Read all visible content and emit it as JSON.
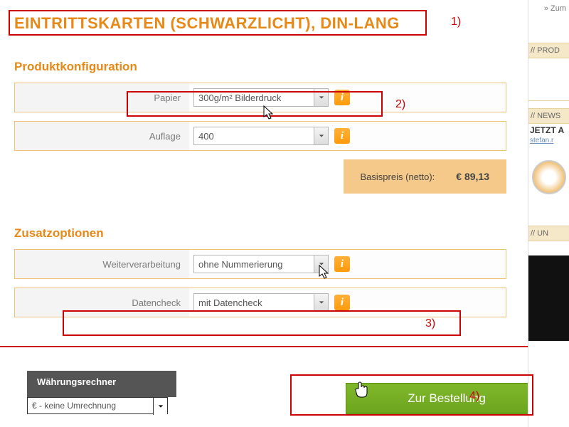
{
  "title": "EINTRITTSKARTEN (SCHWARZLICHT), DIN-LANG",
  "sections": {
    "config": {
      "title": "Produktkonfiguration",
      "paper": {
        "label": "Papier",
        "value": "300g/m² Bilderdruck"
      },
      "quantity": {
        "label": "Auflage",
        "value": "400"
      }
    },
    "price": {
      "label": "Basispreis (netto):",
      "value": "€ 89,13"
    },
    "extras": {
      "title": "Zusatzoptionen",
      "processing": {
        "label": "Weiterverarbeitung",
        "value": "ohne Nummerierung"
      },
      "datacheck": {
        "label": "Datencheck",
        "value": "mit Datencheck"
      }
    }
  },
  "currency": {
    "title": "Währungsrechner",
    "value": "€ - keine Umrechnung"
  },
  "order_button": "Zur Bestellung",
  "annotations": {
    "n1": "1)",
    "n2": "2)",
    "n3": "3)",
    "n4": "4)"
  },
  "sidebar": {
    "top_link": "» Zum",
    "prod": "// PROD",
    "news": "// NEWS",
    "jetzt": "JETZT A",
    "stefan": "stefan.r",
    "un": "// UN"
  },
  "info_glyph": "i"
}
